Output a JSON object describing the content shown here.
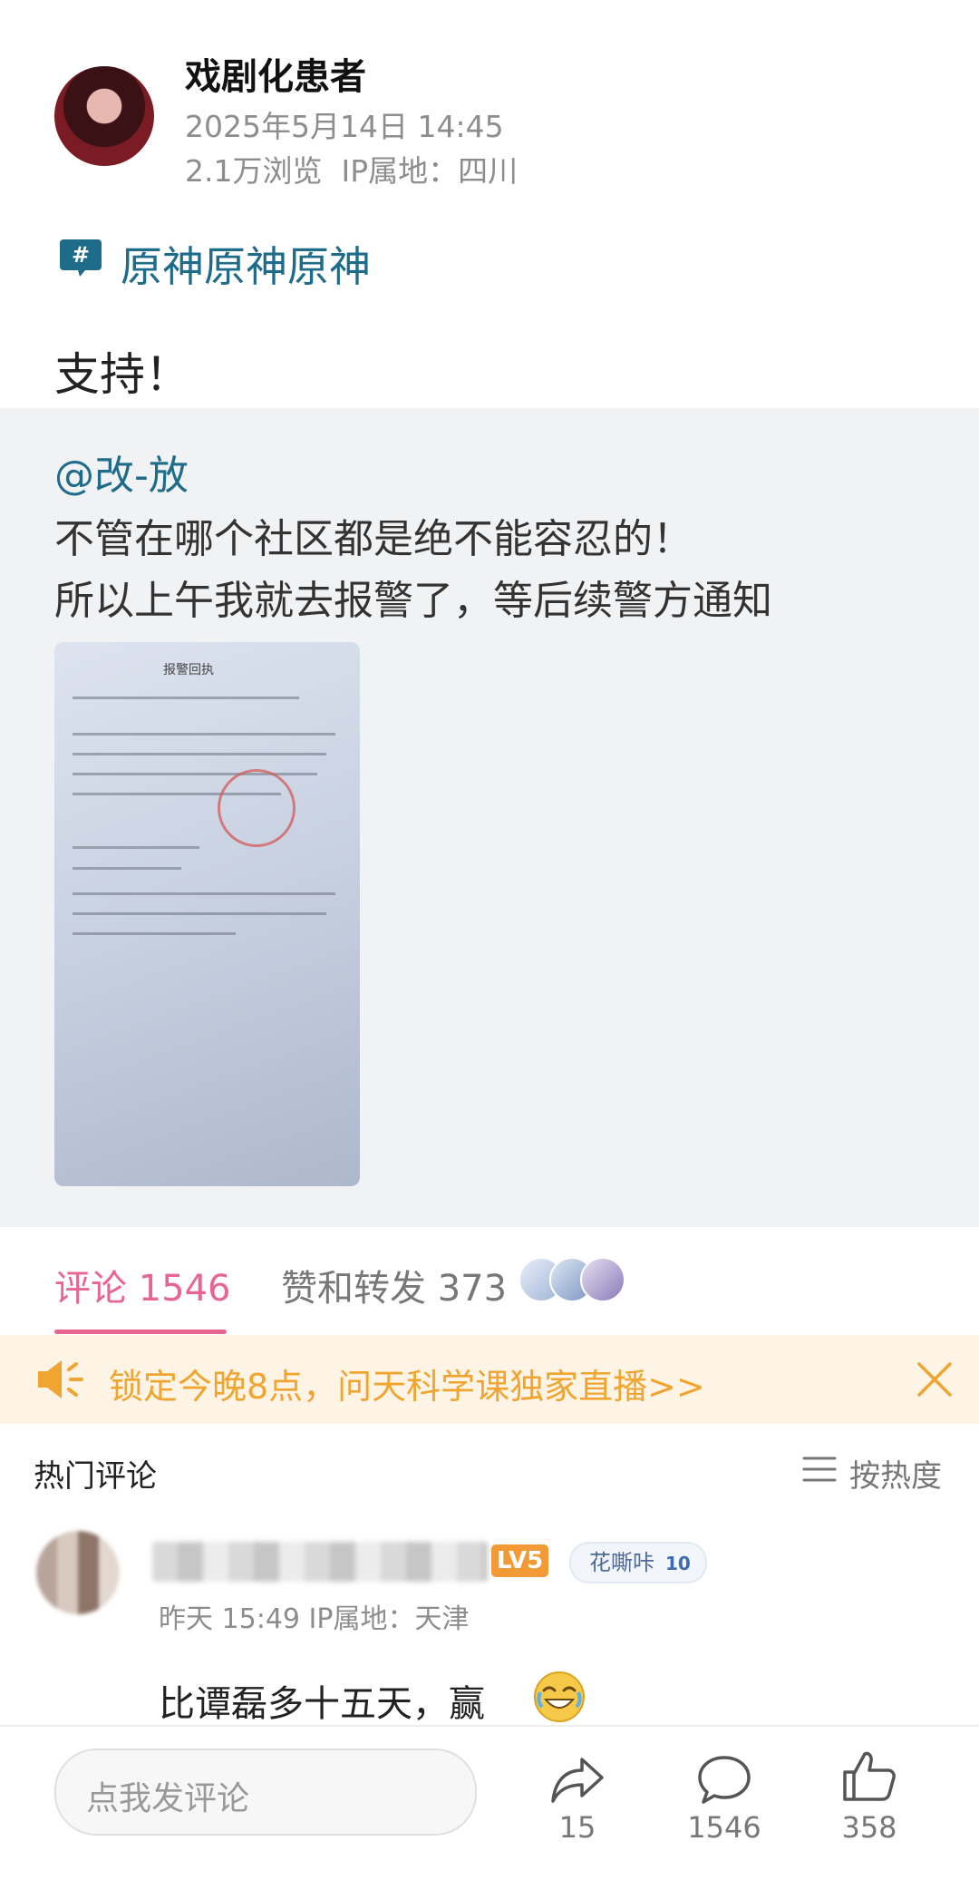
{
  "post": {
    "author": "戏剧化患者",
    "date": "2025年5月14日 14:45",
    "stats": "2.1万浏览  IP属地：四川",
    "topic": "原神原神原神",
    "text": "支持！"
  },
  "repost": {
    "author": "@改-放",
    "line1": "不管在哪个社区都是绝不能容忍的！",
    "line2": "所以上午我就去报警了，等后续警方通知",
    "image_caption": "报警回执"
  },
  "tabs": {
    "comments": "评论 1546",
    "likes": "赞和转发 373"
  },
  "banner": {
    "text": "锁定今晚8点，问天科学课独家直播>>"
  },
  "comments_header": {
    "title": "热门评论",
    "sort": "按热度"
  },
  "comment": {
    "level": "LV5",
    "badge": "花嘶咔",
    "badge_level": "10",
    "meta": "昨天 15:49 IP属地：天津",
    "text": "比谭磊多十五天，赢"
  },
  "bottom": {
    "placeholder": "点我发评论",
    "share_count": "15",
    "comment_count": "1546",
    "like_count": "358"
  },
  "colors": {
    "link": "#1e6b8a",
    "accent": "#e8658f",
    "banner_text": "#f0a531",
    "banner_bg": "#fdf4e5"
  }
}
